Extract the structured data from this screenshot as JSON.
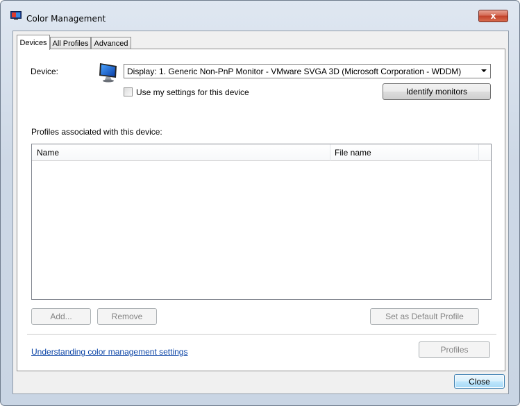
{
  "window": {
    "title": "Color Management",
    "close_glyph": "x"
  },
  "tabs": [
    {
      "label": "Devices",
      "active": true
    },
    {
      "label": "All Profiles",
      "active": false
    },
    {
      "label": "Advanced",
      "active": false
    }
  ],
  "devices": {
    "device_label": "Device:",
    "device_value": "Display: 1. Generic Non-PnP Monitor - VMware SVGA 3D (Microsoft Corporation - WDDM)",
    "use_settings_label": "Use my settings for this device",
    "use_settings_checked": false,
    "identify_button": "Identify monitors",
    "profiles_label": "Profiles associated with this device:",
    "columns": [
      "Name",
      "File name"
    ],
    "rows": [],
    "add_button": "Add...",
    "remove_button": "Remove",
    "set_default_button": "Set as Default Profile",
    "profiles_button": "Profiles",
    "help_link": "Understanding color management settings"
  },
  "footer": {
    "close_button": "Close"
  },
  "colors": {
    "link": "#0b44a6",
    "close_accent": "#c2412a",
    "default_button_border": "#3c7fb1"
  },
  "icons": [
    "color-management-icon",
    "monitor-icon",
    "dropdown-arrow-icon",
    "close-icon"
  ]
}
